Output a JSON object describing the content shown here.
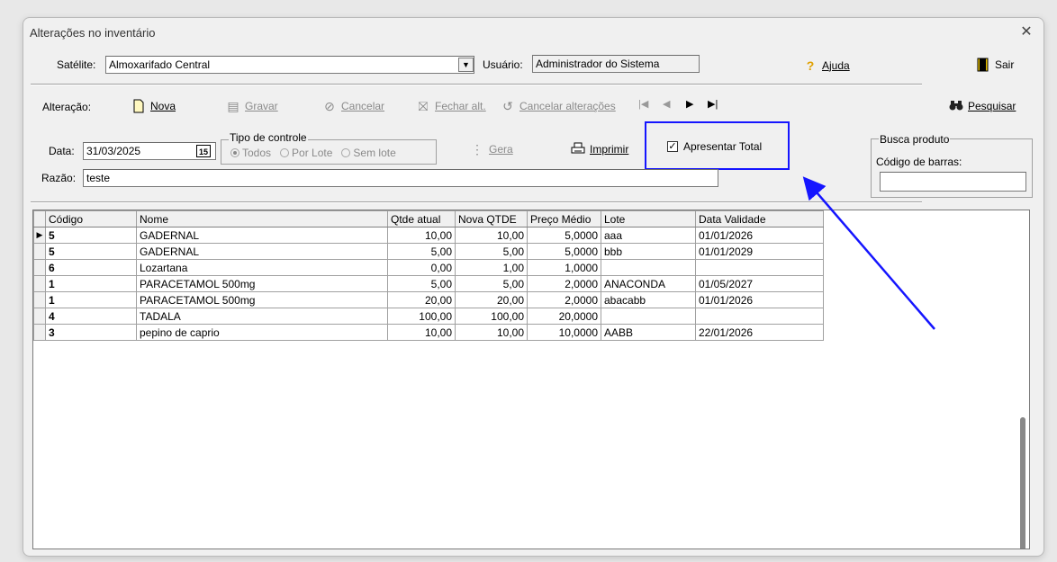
{
  "window": {
    "title": "Alterações no inventário"
  },
  "header": {
    "satelite_label": "Satélite:",
    "satelite_value": "Almoxarifado Central",
    "usuario_label": "Usuário:",
    "usuario_value": "Administrador do Sistema",
    "ajuda_label": "Ajuda",
    "sair_label": "Sair"
  },
  "toolbar": {
    "alteracao_label": "Alteração:",
    "nova_label": "Nova",
    "gravar_label": "Gravar",
    "cancelar_label": "Cancelar",
    "fechar_label": "Fechar alt.",
    "cancelar_alt_label": "Cancelar alterações",
    "pesquisar_label": "Pesquisar"
  },
  "form": {
    "data_label": "Data:",
    "data_value": "31/03/2025",
    "cal_icon_text": "15",
    "tipo_title": "Tipo de controle",
    "radio_todos": "Todos",
    "radio_lote": "Por Lote",
    "radio_sem": "Sem lote",
    "gera_label": "Gera",
    "imprimir_label": "Imprimir",
    "apresentar_label": "Apresentar Total",
    "apresentar_checked": true,
    "razao_label": "Razão:",
    "razao_value": "teste",
    "busca_title": "Busca produto",
    "codigo_barras_label": "Código de barras:",
    "codigo_barras_value": ""
  },
  "grid": {
    "columns": [
      "Código",
      "Nome",
      "Qtde atual",
      "Nova QTDE",
      "Preço Médio",
      "Lote",
      "Data Validade"
    ],
    "rows": [
      {
        "codigo": "5",
        "nome": "GADERNAL",
        "qtde": "10,00",
        "nova": "10,00",
        "preco": "5,0000",
        "lote": "aaa",
        "validade": "01/01/2026",
        "current": true
      },
      {
        "codigo": "5",
        "nome": "GADERNAL",
        "qtde": "5,00",
        "nova": "5,00",
        "preco": "5,0000",
        "lote": "bbb",
        "validade": "01/01/2029",
        "current": false
      },
      {
        "codigo": "6",
        "nome": "Lozartana",
        "qtde": "0,00",
        "nova": "1,00",
        "preco": "1,0000",
        "lote": "",
        "validade": "",
        "current": false
      },
      {
        "codigo": "1",
        "nome": "PARACETAMOL 500mg",
        "qtde": "5,00",
        "nova": "5,00",
        "preco": "2,0000",
        "lote": "ANACONDA",
        "validade": "01/05/2027",
        "current": false
      },
      {
        "codigo": "1",
        "nome": "PARACETAMOL 500mg",
        "qtde": "20,00",
        "nova": "20,00",
        "preco": "2,0000",
        "lote": "abacabb",
        "validade": "01/01/2026",
        "current": false
      },
      {
        "codigo": "4",
        "nome": "TADALA",
        "qtde": "100,00",
        "nova": "100,00",
        "preco": "20,0000",
        "lote": "",
        "validade": "",
        "current": false
      },
      {
        "codigo": "3",
        "nome": "pepino de caprio",
        "qtde": "10,00",
        "nova": "10,00",
        "preco": "10,0000",
        "lote": "AABB",
        "validade": "22/01/2026",
        "current": false
      }
    ]
  },
  "icons": {
    "nova": "new-document-icon",
    "gravar": "save-icon",
    "cancelar": "cancel-icon",
    "fechar": "close-record-icon",
    "cancelar_alt": "undo-icon",
    "pesquisar": "binoculars-icon",
    "ajuda": "question-icon",
    "sair": "exit-door-icon"
  },
  "colors": {
    "highlight": "#1515ff",
    "arrow": "#1515ff"
  }
}
